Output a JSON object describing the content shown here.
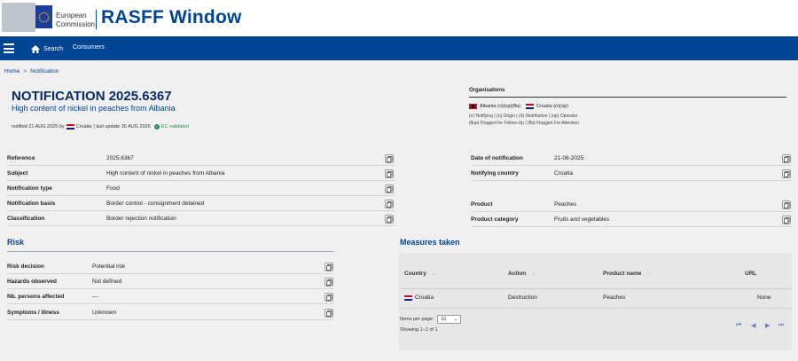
{
  "header": {
    "org_line1": "European",
    "org_line2": "Commission",
    "app_title": "RASFF Window"
  },
  "nav": {
    "menu_icon": "hamburger-icon",
    "search_label": "Search",
    "consumers_label": "Consumers"
  },
  "breadcrumb": {
    "home": "Home",
    "separator": ">",
    "current": "Notification"
  },
  "notification": {
    "title": "NOTIFICATION 2025.6367",
    "subtitle": "High content of nickel in peaches from Albania",
    "meta_notified": "notified 21 AUG 2025 by",
    "meta_country": "Croatia",
    "meta_update": "| last update 26 AUG 2025",
    "meta_validated": "EC validated"
  },
  "organisations": {
    "title": "Organisations",
    "albania": "Albania (o)(op)(ffa)",
    "croatia": "Croatia (n)(op)",
    "legend1": "(n) Notifying | (o) Origin | (d) Distribution | (op) Operator",
    "legend2": "(flup) Flagged for Follow-Up | (ffa) Flagged For Attention"
  },
  "details_left": [
    {
      "label": "Reference",
      "value": "2025.6367"
    },
    {
      "label": "Subject",
      "value": "High content of nickel in peaches from Albania"
    },
    {
      "label": "Notification type",
      "value": "Food"
    },
    {
      "label": "Notification basis",
      "value": "Border control - consignment detained"
    },
    {
      "label": "Classification",
      "value": "Border rejection notification"
    }
  ],
  "details_right": [
    {
      "label": "Date of notification",
      "value": "21-08-2025"
    },
    {
      "label": "Notifying country",
      "value": "Croatia"
    },
    {
      "label": "Product",
      "value": "Peaches"
    },
    {
      "label": "Product category",
      "value": "Fruits and vegetables"
    }
  ],
  "risk": {
    "title": "Risk",
    "rows": [
      {
        "label": "Risk decision",
        "value": "Potential risk"
      },
      {
        "label": "Hazards observed",
        "value": "Not defined"
      },
      {
        "label": "Nb. persons affected",
        "value": "---"
      },
      {
        "label": "Symptoms / Illness",
        "value": "Unknown"
      }
    ]
  },
  "measures": {
    "title": "Measures taken",
    "columns": [
      "Country",
      "Action",
      "Product name",
      "URL"
    ],
    "rows": [
      {
        "country": "Croatia",
        "action": "Destruction",
        "product": "Peaches",
        "url": "None"
      }
    ],
    "items_per_page_label": "Items per page:",
    "items_per_page": "10",
    "showing": "Showing 1–1 of 1"
  },
  "colors": {
    "brand": "#004494",
    "validated": "#2e8b57"
  }
}
